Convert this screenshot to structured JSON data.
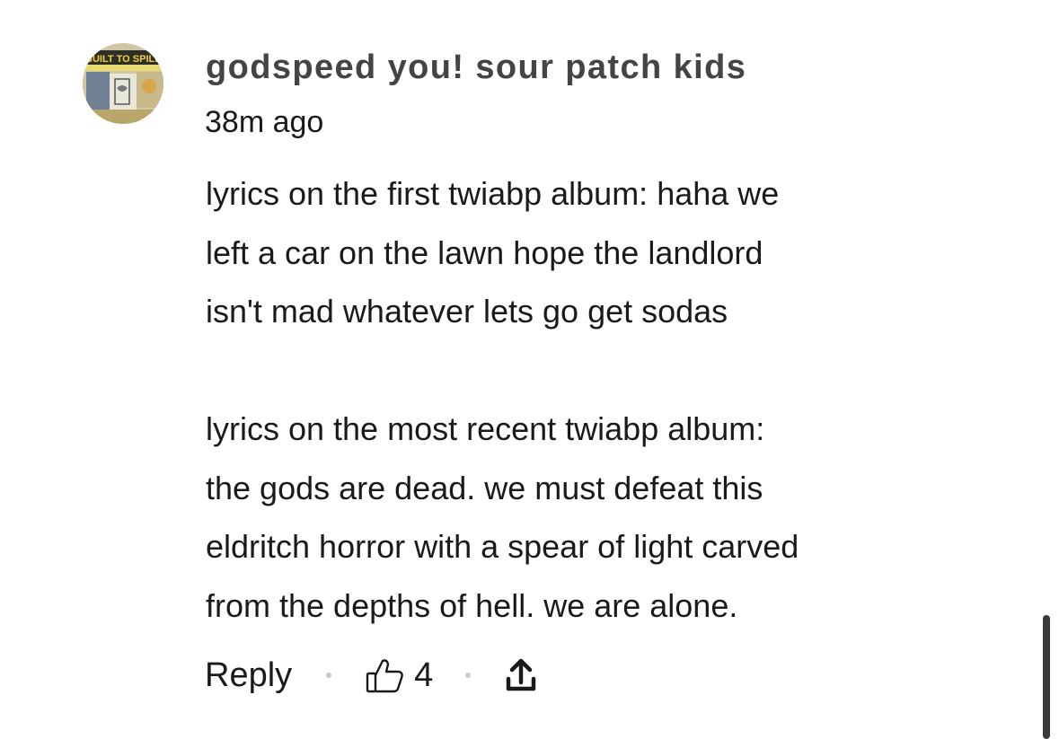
{
  "comment": {
    "avatar": {
      "icon": "band-album-art-avatar",
      "text": "BUILT TO SPILL"
    },
    "username": "godspeed you! sour patch kids",
    "timestamp": "38m ago",
    "body": {
      "paragraphs": [
        [
          "lyrics on the first twiabp album: haha we",
          "left a car on the lawn hope the landlord",
          "isn't mad whatever lets go get sodas"
        ],
        [
          "lyrics on the most recent twiabp album:",
          "the gods are dead. we must defeat this",
          "eldritch horror with a spear of light carved",
          "from the depths of hell. we are alone."
        ]
      ]
    },
    "actions": {
      "reply_label": "Reply",
      "like_icon": "thumbs-up-icon",
      "like_count": "4",
      "share_icon": "share-upload-icon"
    }
  }
}
